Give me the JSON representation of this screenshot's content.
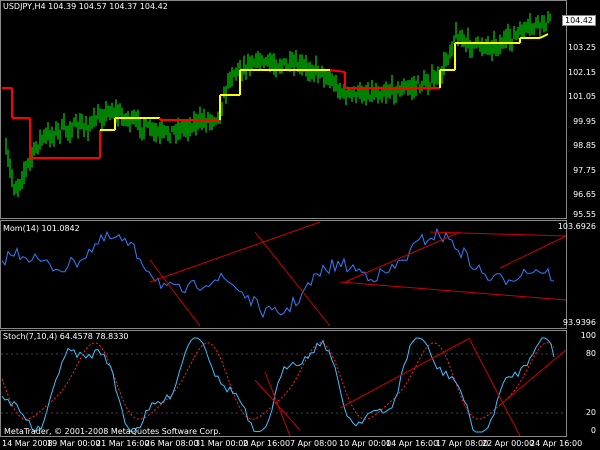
{
  "main_panel": {
    "header": "USDJPY,H4  104.39 104.57 104.37 104.42",
    "current_price": "104.42",
    "price_ticks": [
      "103.25",
      "102.15",
      "101.05",
      "99.95",
      "98.85",
      "97.75",
      "96.65",
      "95.55"
    ]
  },
  "momentum_panel": {
    "header": "Mom(14) 101.0842",
    "ticks": [
      "103.6926",
      "93.9396"
    ]
  },
  "stoch_panel": {
    "header": "Stoch(7,10,4) 64.4578 78.8330",
    "ticks": [
      "100",
      "80",
      "20",
      "0"
    ]
  },
  "time_axis": [
    "14 Mar 2008",
    "19 Mar 00:00",
    "21 Mar 16:00",
    "26 Mar 08:00",
    "31 Mar 00:00",
    "2 Apr 16:00",
    "7 Apr 08:00",
    "10 Apr 00:00",
    "14 Apr 16:00",
    "17 Apr 08:00",
    "22 Apr 00:00",
    "24 Apr 16:00"
  ],
  "copyright": "MetaTrader, © 2001-2008 MetaQuotes Software Corp.",
  "colors": {
    "background": "#000000",
    "candles": "#00ff00",
    "trail_up": "#ffff00",
    "trail_down": "#ff0000",
    "indicator": "#2f7fff",
    "signal": "#ff2020",
    "trendline": "#cc0000",
    "grid": "#888888"
  }
}
